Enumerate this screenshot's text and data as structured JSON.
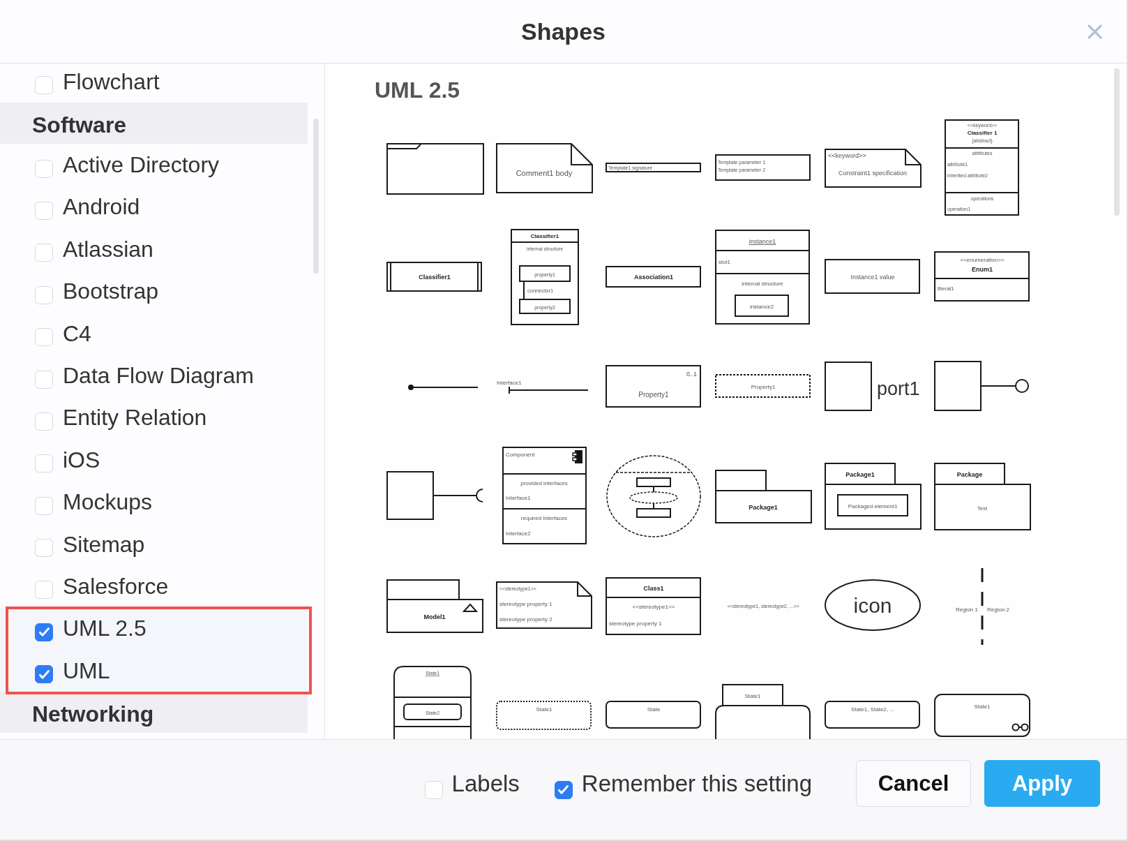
{
  "window": {
    "title": "Shapes"
  },
  "sidebar": {
    "groups": [
      {
        "items": [
          {
            "label": "Flowchart",
            "checked": false,
            "highlighted": false
          }
        ]
      },
      {
        "title": "Software",
        "items": [
          {
            "label": "Active Directory",
            "checked": false,
            "highlighted": false
          },
          {
            "label": "Android",
            "checked": false,
            "highlighted": false
          },
          {
            "label": "Atlassian",
            "checked": false,
            "highlighted": false
          },
          {
            "label": "Bootstrap",
            "checked": false,
            "highlighted": false
          },
          {
            "label": "C4",
            "checked": false,
            "highlighted": false
          },
          {
            "label": "Data Flow Diagram",
            "checked": false,
            "highlighted": false
          },
          {
            "label": "Entity Relation",
            "checked": false,
            "highlighted": false
          },
          {
            "label": "iOS",
            "checked": false,
            "highlighted": false
          },
          {
            "label": "Mockups",
            "checked": false,
            "highlighted": false
          },
          {
            "label": "Sitemap",
            "checked": false,
            "highlighted": false
          },
          {
            "label": "Salesforce",
            "checked": false,
            "highlighted": false
          },
          {
            "label": "UML 2.5",
            "checked": true,
            "highlighted": true
          },
          {
            "label": "UML",
            "checked": true,
            "highlighted": true
          }
        ]
      },
      {
        "title": "Networking"
      }
    ]
  },
  "preview": {
    "title": "UML 2.5",
    "shapes": [
      {
        "kind": "frame"
      },
      {
        "kind": "note",
        "texts": [
          "Comment1 body"
        ]
      },
      {
        "kind": "signature-bar",
        "texts": [
          "Template1 signature"
        ]
      },
      {
        "kind": "template-box",
        "texts": [
          "Template parameter 1",
          "Template parameter 2"
        ]
      },
      {
        "kind": "keyword-note",
        "texts": [
          "<<keyword>>",
          "Constraint1 specification"
        ]
      },
      {
        "kind": "classifier-full",
        "texts": [
          "<<keyword>>",
          "Classifier 1",
          "{abstract}",
          "attributes",
          "attribute1",
          "inherited attribute2",
          "operations",
          "operation1"
        ]
      },
      {
        "kind": "active-class",
        "texts": [
          "Classifier1"
        ]
      },
      {
        "kind": "composite",
        "texts": [
          "Classifier1",
          "internal structure",
          "property1",
          "connector1",
          "property2"
        ]
      },
      {
        "kind": "bold-box",
        "texts": [
          "Association1"
        ]
      },
      {
        "kind": "instance",
        "texts": [
          "instance1",
          "slot1",
          "internal structure",
          "instance2"
        ]
      },
      {
        "kind": "box",
        "texts": [
          "Instance1 value"
        ]
      },
      {
        "kind": "enumeration",
        "texts": [
          "<<enumeration>>",
          "Enum1",
          "literal1"
        ]
      },
      {
        "kind": "dot-line"
      },
      {
        "kind": "interface-line",
        "texts": [
          "Interface1"
        ]
      },
      {
        "kind": "multiplicity-box",
        "texts": [
          "0..1",
          "Property1"
        ]
      },
      {
        "kind": "dashed-box",
        "texts": [
          "Property1"
        ]
      },
      {
        "kind": "port",
        "texts": [
          "port1"
        ]
      },
      {
        "kind": "lollipop"
      },
      {
        "kind": "socket"
      },
      {
        "kind": "component",
        "texts": [
          "Component",
          "provided interfaces",
          "Interface1",
          "required interfaces",
          "Interface2"
        ]
      },
      {
        "kind": "collaboration"
      },
      {
        "kind": "package",
        "texts": [
          "Package1"
        ]
      },
      {
        "kind": "package-element",
        "texts": [
          "Package1",
          "Packaged element1"
        ]
      },
      {
        "kind": "package-text",
        "texts": [
          "Package",
          "Text"
        ]
      },
      {
        "kind": "model",
        "texts": [
          "Model1"
        ]
      },
      {
        "kind": "stereotype-note",
        "texts": [
          "<<stereotype1>>",
          "stereotype property 1",
          "stereotype property 2"
        ]
      },
      {
        "kind": "stereotype-class",
        "texts": [
          "Class1",
          "<<stereotype1>>",
          "stereotype property 1"
        ]
      },
      {
        "kind": "label",
        "texts": [
          "<<stereotype1, stereotype2, ...>>"
        ]
      },
      {
        "kind": "ellipse",
        "texts": [
          "icon"
        ]
      },
      {
        "kind": "regions",
        "texts": [
          "Region 1",
          "Region 2"
        ]
      },
      {
        "kind": "composite-state",
        "texts": [
          "State1",
          "State2"
        ]
      },
      {
        "kind": "dotted-state",
        "texts": [
          "State1"
        ]
      },
      {
        "kind": "state",
        "texts": [
          "State"
        ]
      },
      {
        "kind": "tab-state",
        "texts": [
          "State1"
        ]
      },
      {
        "kind": "state",
        "texts": [
          "State1, State2, ..."
        ]
      },
      {
        "kind": "submachine-state",
        "texts": [
          "State1"
        ]
      }
    ]
  },
  "footer": {
    "options": [
      {
        "label": "Labels",
        "checked": false
      },
      {
        "label": "Remember this setting",
        "checked": true
      }
    ],
    "buttons": [
      {
        "label": "Cancel",
        "kind": "secondary"
      },
      {
        "label": "Apply",
        "kind": "primary"
      }
    ]
  }
}
